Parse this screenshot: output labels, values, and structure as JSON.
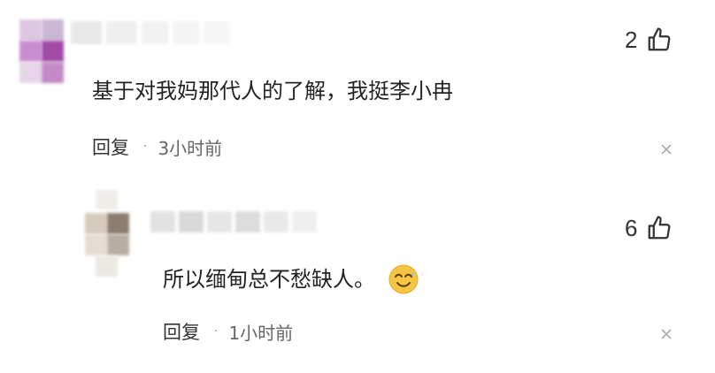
{
  "comments": [
    {
      "likes": "2",
      "text": "基于对我妈那代人的了解，我挺李小冉",
      "reply_label": "回复",
      "separator": "·",
      "time": "3小时前"
    },
    {
      "likes": "6",
      "text": "所以缅甸总不愁缺人。",
      "emoji": "smiling-face-emoji",
      "reply_label": "回复",
      "separator": "·",
      "time": "1小时前"
    }
  ],
  "icons": {
    "like": "thumbs-up-icon",
    "close": "close-icon"
  },
  "colors": {
    "avatar1": [
      "#a33fa5",
      "#c889c9",
      "#e6c8e6",
      "#d8d8d8"
    ],
    "avatar2": [
      "#8a7d74",
      "#bdb3a9",
      "#e3dcd4",
      "#cfcfcf"
    ],
    "emoji": "#f6c542"
  }
}
